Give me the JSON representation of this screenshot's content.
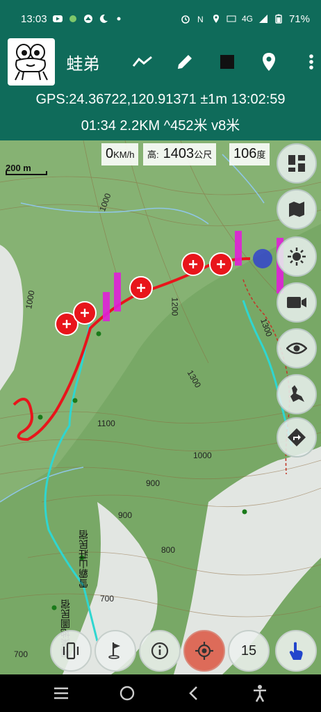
{
  "status_bar": {
    "time": "13:03",
    "network": "4G",
    "battery": "71%"
  },
  "app_bar": {
    "title": "蛙弟"
  },
  "gps": {
    "coords_line": "GPS:24.36722,120.91371 ±1m 13:02:59",
    "trip_line": "01:34  2.2KM  ^452米  v8米"
  },
  "info": {
    "speed_value": "0",
    "speed_unit": "KM/h",
    "alt_label": "高:",
    "alt_value": "1403",
    "alt_unit": "公尺",
    "heading_value": "106",
    "heading_unit": "度"
  },
  "map": {
    "scale_label": "200 m",
    "contour_labels": [
      "1000",
      "1000",
      "1100",
      "1000",
      "900",
      "900",
      "800",
      "700",
      "700",
      "1300",
      "1300",
      "1200"
    ],
    "place_labels": [
      "雪霸山莊民宿",
      "楓葉地圖民宿"
    ],
    "colors": {
      "track": "#e8151b",
      "trail": "#2fd6d0",
      "label_magenta": "#e020d8",
      "forest": "#78a866",
      "clearing": "#e2e6e2"
    }
  },
  "side_buttons": [
    {
      "name": "layers-icon"
    },
    {
      "name": "map-icon"
    },
    {
      "name": "brightness-icon"
    },
    {
      "name": "camera-icon"
    },
    {
      "name": "eye-icon"
    },
    {
      "name": "frog-icon"
    },
    {
      "name": "directions-icon"
    }
  ],
  "bottom_buttons": {
    "zoom_level": "15"
  }
}
